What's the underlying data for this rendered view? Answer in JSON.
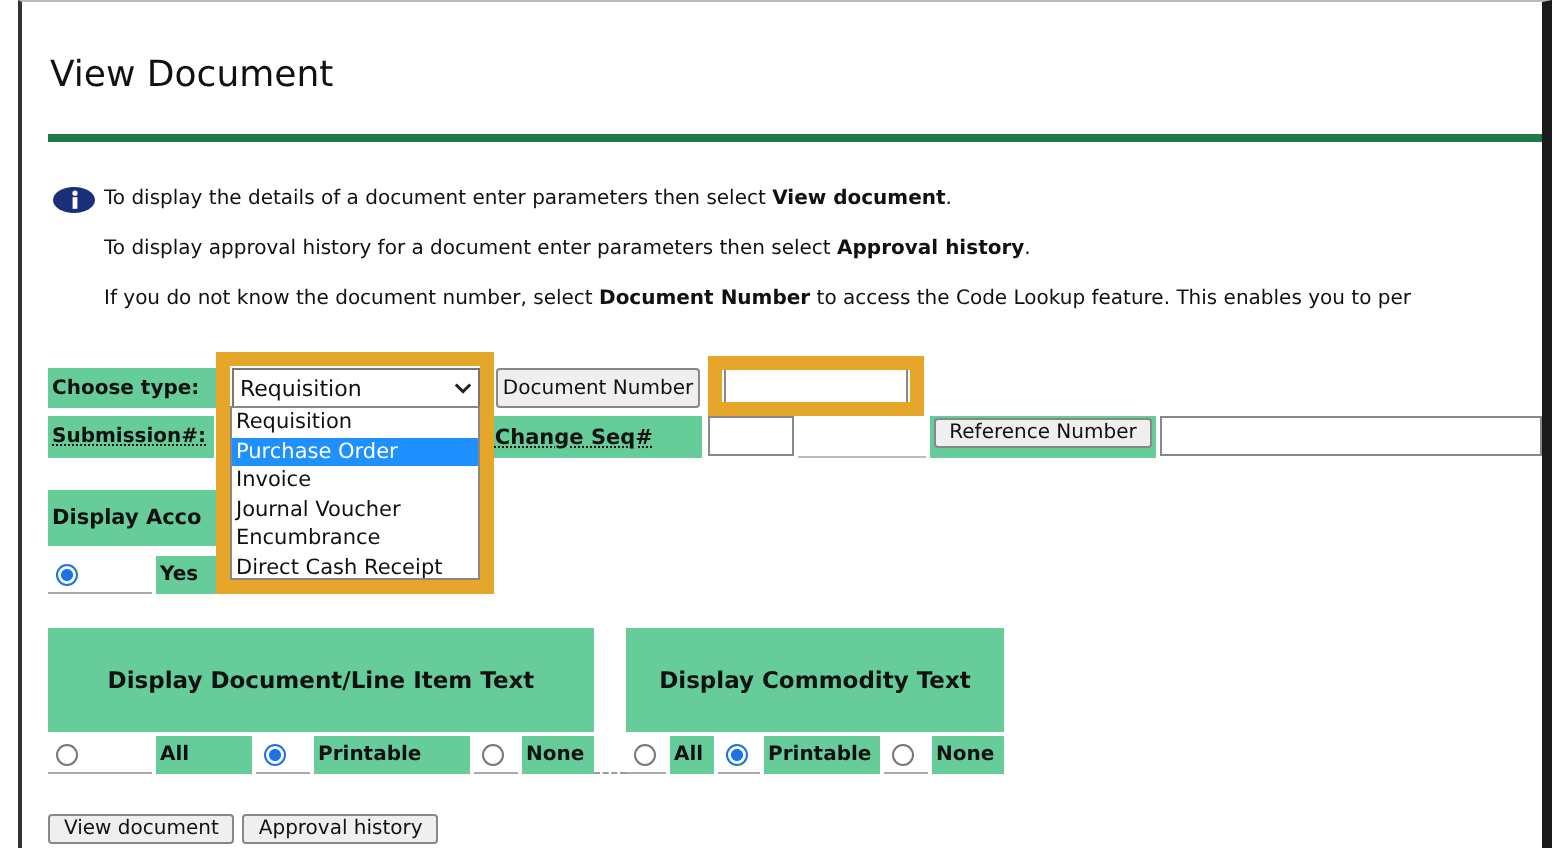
{
  "window": {
    "title": "View Document"
  },
  "instructions": [
    {
      "kind": "info",
      "text": "To display the details of a document enter parameters then select **View document**."
    },
    {
      "kind": "plain",
      "text": "To display approval history for a document enter parameters then select **Approval history**."
    },
    {
      "kind": "plain",
      "text": "If you do not know the document number, select **Document Number** to access the Code Lookup feature. This enables you to per"
    }
  ],
  "form": {
    "choose_type_label": "Choose type:",
    "type_value": "Requisition",
    "type_options": [
      {
        "label": "Requisition",
        "selected": false
      },
      {
        "label": "Purchase Order",
        "selected": true
      },
      {
        "label": "Invoice",
        "selected": false
      },
      {
        "label": "Journal Voucher",
        "selected": false
      },
      {
        "label": "Encumbrance",
        "selected": false
      },
      {
        "label": "Direct Cash Receipt",
        "selected": false
      }
    ],
    "document_number_button": "Document Number",
    "submission_label": "Submission#:",
    "change_seq_label": "Change Seq#",
    "reference_number_button": "Reference Number",
    "display_accounting": {
      "label": "Display Acco",
      "options": [
        {
          "label": "Yes",
          "selected": true
        }
      ]
    }
  },
  "text_sections": [
    {
      "title": "Display Document/Line Item Text",
      "options": [
        {
          "label": "All",
          "selected": false
        },
        {
          "label": "Printable",
          "selected": true
        },
        {
          "label": "None",
          "selected": false
        }
      ]
    },
    {
      "title": "Display Commodity Text",
      "options": [
        {
          "label": "All",
          "selected": false
        },
        {
          "label": "Printable",
          "selected": true
        },
        {
          "label": "None",
          "selected": false
        }
      ]
    }
  ],
  "buttons": [
    "View document",
    "Approval history"
  ]
}
